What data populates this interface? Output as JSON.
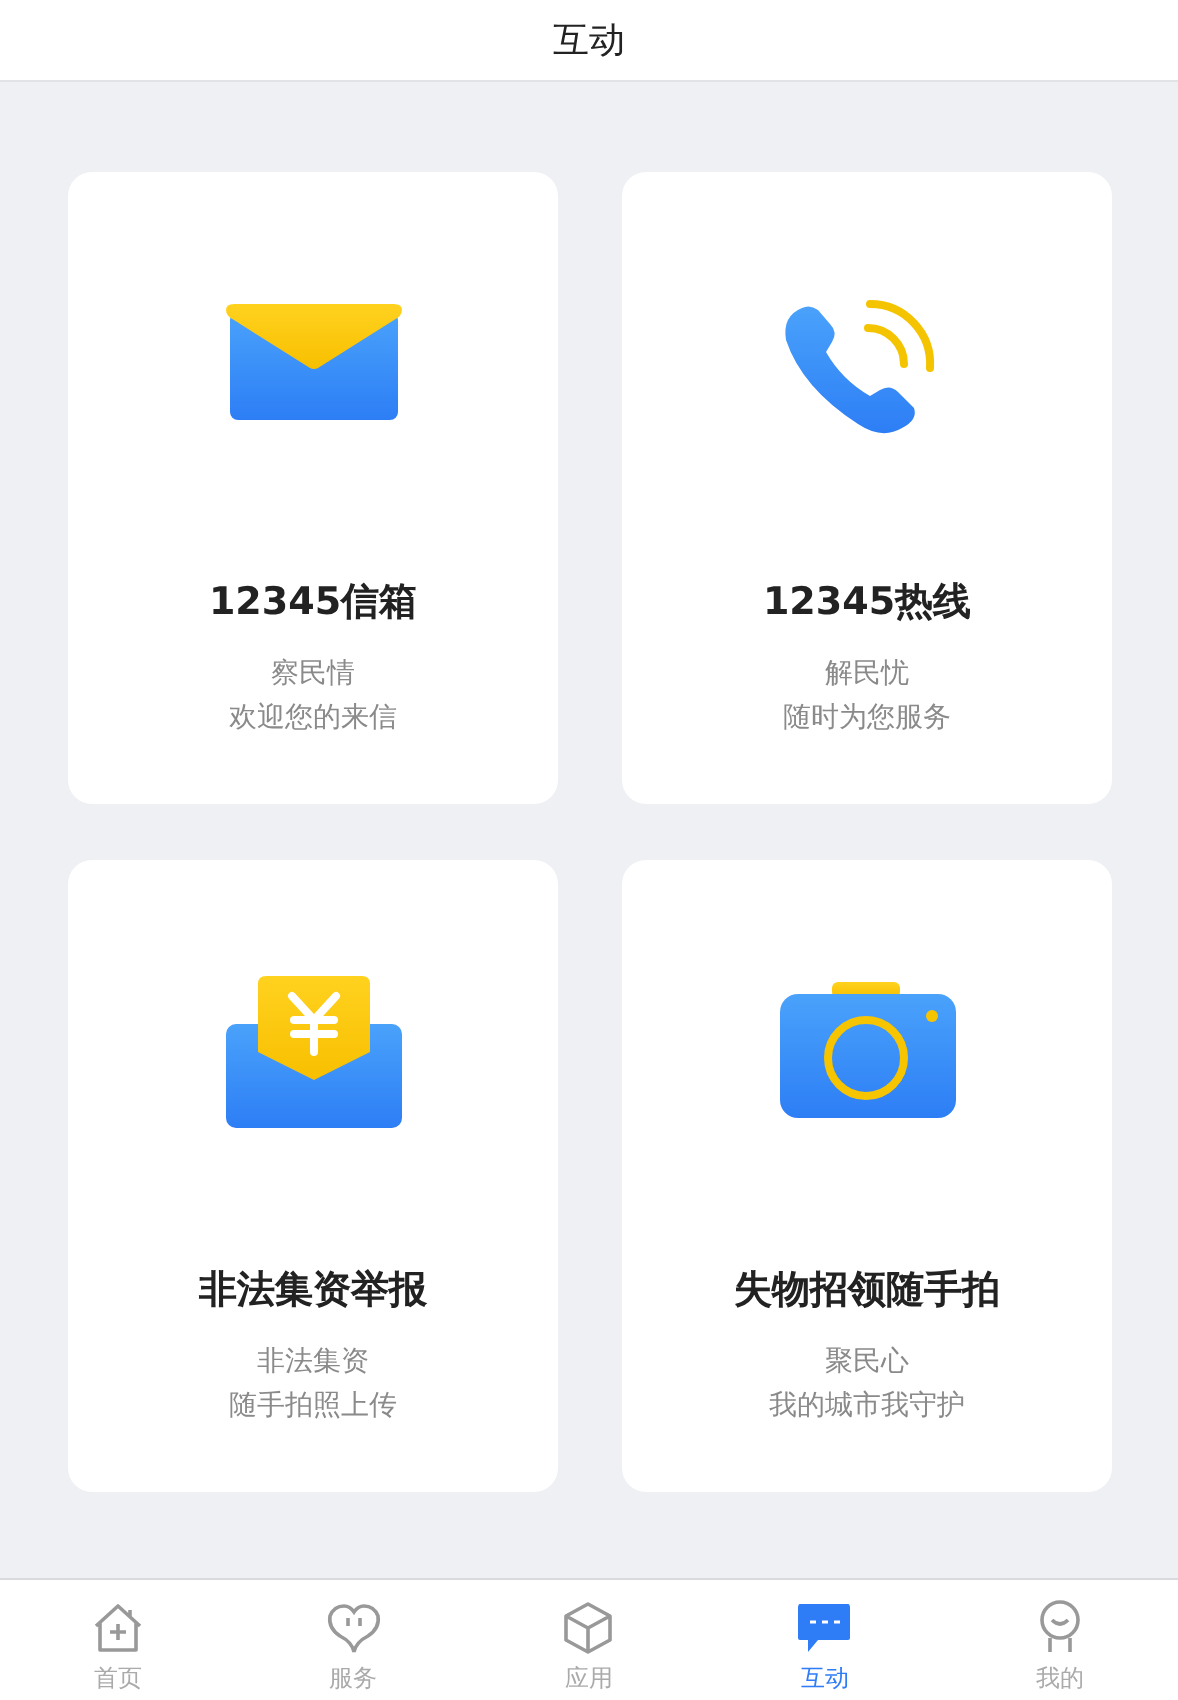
{
  "header": {
    "title": "互动"
  },
  "cards": [
    {
      "kind": "mail",
      "title": "12345信箱",
      "lines": [
        "察民情",
        "欢迎您的来信"
      ]
    },
    {
      "kind": "phone",
      "title": "12345热线",
      "lines": [
        "解民忧",
        "随时为您服务"
      ]
    },
    {
      "kind": "money",
      "title": "非法集资举报",
      "lines": [
        "非法集资",
        "随手拍照上传"
      ]
    },
    {
      "kind": "camera",
      "title": "失物招领随手拍",
      "lines": [
        "聚民心",
        "我的城市我守护"
      ]
    }
  ],
  "tab_bar": [
    {
      "kind": "home",
      "label": "首页",
      "selected": false
    },
    {
      "kind": "heart",
      "label": "服务",
      "selected": false
    },
    {
      "kind": "cube",
      "label": "应用",
      "selected": false
    },
    {
      "kind": "chat",
      "label": "互动",
      "selected": true
    },
    {
      "kind": "person",
      "label": "我的",
      "selected": false
    }
  ]
}
